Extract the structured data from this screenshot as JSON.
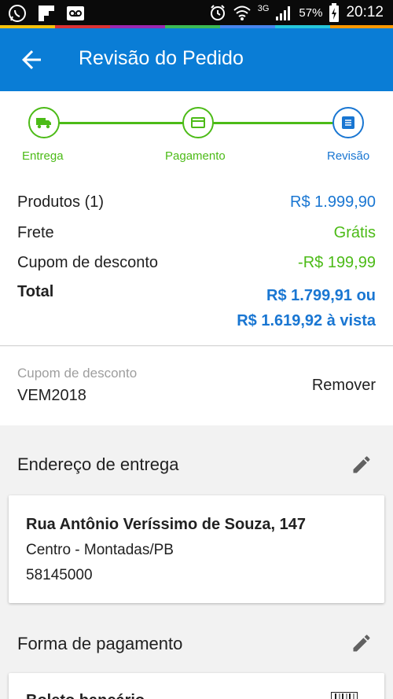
{
  "status_bar": {
    "signal_label": "3G",
    "battery": "57%",
    "time": "20:12"
  },
  "header": {
    "title": "Revisão do Pedido"
  },
  "stepper": {
    "steps": [
      {
        "label": "Entrega",
        "icon": "truck-icon",
        "state": "done"
      },
      {
        "label": "Pagamento",
        "icon": "card-icon",
        "state": "done"
      },
      {
        "label": "Revisão",
        "icon": "list-icon",
        "state": "active"
      }
    ]
  },
  "summary": {
    "products_label": "Produtos (1)",
    "products_value": "R$ 1.999,90",
    "shipping_label": "Frete",
    "shipping_value": "Grátis",
    "coupon_label": "Cupom de desconto",
    "coupon_value": "-R$ 199,99",
    "total_label": "Total",
    "total_value_line1": "R$ 1.799,91 ou",
    "total_value_line2": "R$ 1.619,92 à vista"
  },
  "coupon": {
    "label": "Cupom de desconto",
    "code": "VEM2018",
    "remove_label": "Remover"
  },
  "delivery": {
    "title": "Endereço de entrega",
    "street": "Rua Antônio Veríssimo de Souza, 147",
    "district_city": "Centro - Montadas/PB",
    "zip": "58145000"
  },
  "payment": {
    "title": "Forma de pagamento",
    "method": "Boleto bancário"
  },
  "colors": {
    "primary": "#0a7dd6",
    "accent_blue": "#1976d2",
    "success_green": "#4cbb17"
  }
}
